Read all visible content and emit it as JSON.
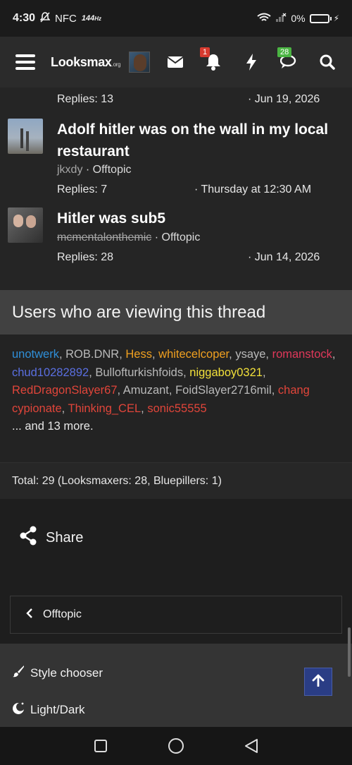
{
  "status_bar": {
    "time": "4:30",
    "nfc": "NFC",
    "refresh": "144",
    "refresh_unit": "Hz",
    "battery": "0%"
  },
  "header": {
    "logo_main": "Looksmax",
    "logo_suffix": ".org",
    "alerts_badge": "1",
    "conversations_badge": "28"
  },
  "threads": [
    {
      "replies": "Replies: 13",
      "date": "· Jun 19, 2026"
    },
    {
      "title": "Adolf hitler was on the wall in my local restaurant",
      "author": "jkxdy",
      "forum": "Offtopic",
      "replies": "Replies: 7",
      "date": "· Thursday at 12:30 AM"
    },
    {
      "title": "Hitler was sub5",
      "author": "mcmentalonthemic",
      "forum": "Offtopic",
      "replies": "Replies: 28",
      "date": "· Jun 14, 2026"
    }
  ],
  "viewers": {
    "heading": "Users who are viewing this thread",
    "users": [
      {
        "name": "unotwerk",
        "color": "#2f8fd8"
      },
      {
        "name": "ROB.DNR",
        "color": "#b9b9b9"
      },
      {
        "name": "Hess",
        "color": "#f0a020"
      },
      {
        "name": "whitecelcoper",
        "color": "#f0a020"
      },
      {
        "name": "ysaye",
        "color": "#b9b9b9"
      },
      {
        "name": "romanstock",
        "color": "#e0385a"
      },
      {
        "name": "chud10282892",
        "color": "#5a6fe0"
      },
      {
        "name": "Bullofturkishfoids",
        "color": "#b9b9b9"
      },
      {
        "name": "niggaboy0321",
        "color": "#f2e03a"
      },
      {
        "name": "RedDragonSlayer67",
        "color": "#e0453a"
      },
      {
        "name": "Amuzant",
        "color": "#b9b9b9"
      },
      {
        "name": "FoidSlayer2716mil",
        "color": "#b9b9b9"
      },
      {
        "name": "chang cypionate",
        "color": "#e0453a"
      },
      {
        "name": "Thinking_CEL",
        "color": "#e0453a"
      },
      {
        "name": "sonic55555",
        "color": "#e0453a"
      }
    ],
    "more": "... and 13 more.",
    "total": "Total: 29 (Looksmaxers: 28, Bluepillers: 1)"
  },
  "share_label": "Share",
  "breadcrumb": "Offtopic",
  "footer": {
    "style_chooser": "Style chooser",
    "light_dark": "Light/Dark"
  },
  "icons": [
    "menu-icon",
    "envelope-icon",
    "bell-icon",
    "bolt-icon",
    "chat-icon",
    "search-icon",
    "share-icon",
    "chevron-left-icon",
    "brush-icon",
    "moon-icon",
    "arrow-up-icon"
  ]
}
